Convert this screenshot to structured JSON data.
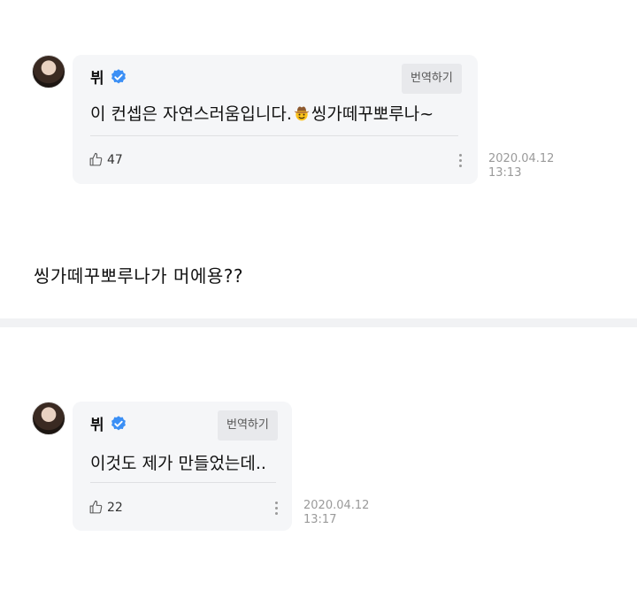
{
  "comments": [
    {
      "author": "뷔",
      "translate_label": "번역하기",
      "text_before_emoji": "이 컨셉은 자연스러움입니다.",
      "emoji": "cowboy-emoji",
      "text_after_emoji": "씽가떼꾸뽀루나~",
      "likes": "47",
      "date": "2020.04.12",
      "time": "13:13"
    },
    {
      "author": "뷔",
      "translate_label": "번역하기",
      "text": "이것도 제가 만들었는데..",
      "likes": "22",
      "date": "2020.04.12",
      "time": "13:17"
    }
  ],
  "reply_text": "씽가떼꾸뽀루나가 머에용??",
  "colors": {
    "verified": "#3b8ff5",
    "bubble": "#f5f6f8"
  }
}
